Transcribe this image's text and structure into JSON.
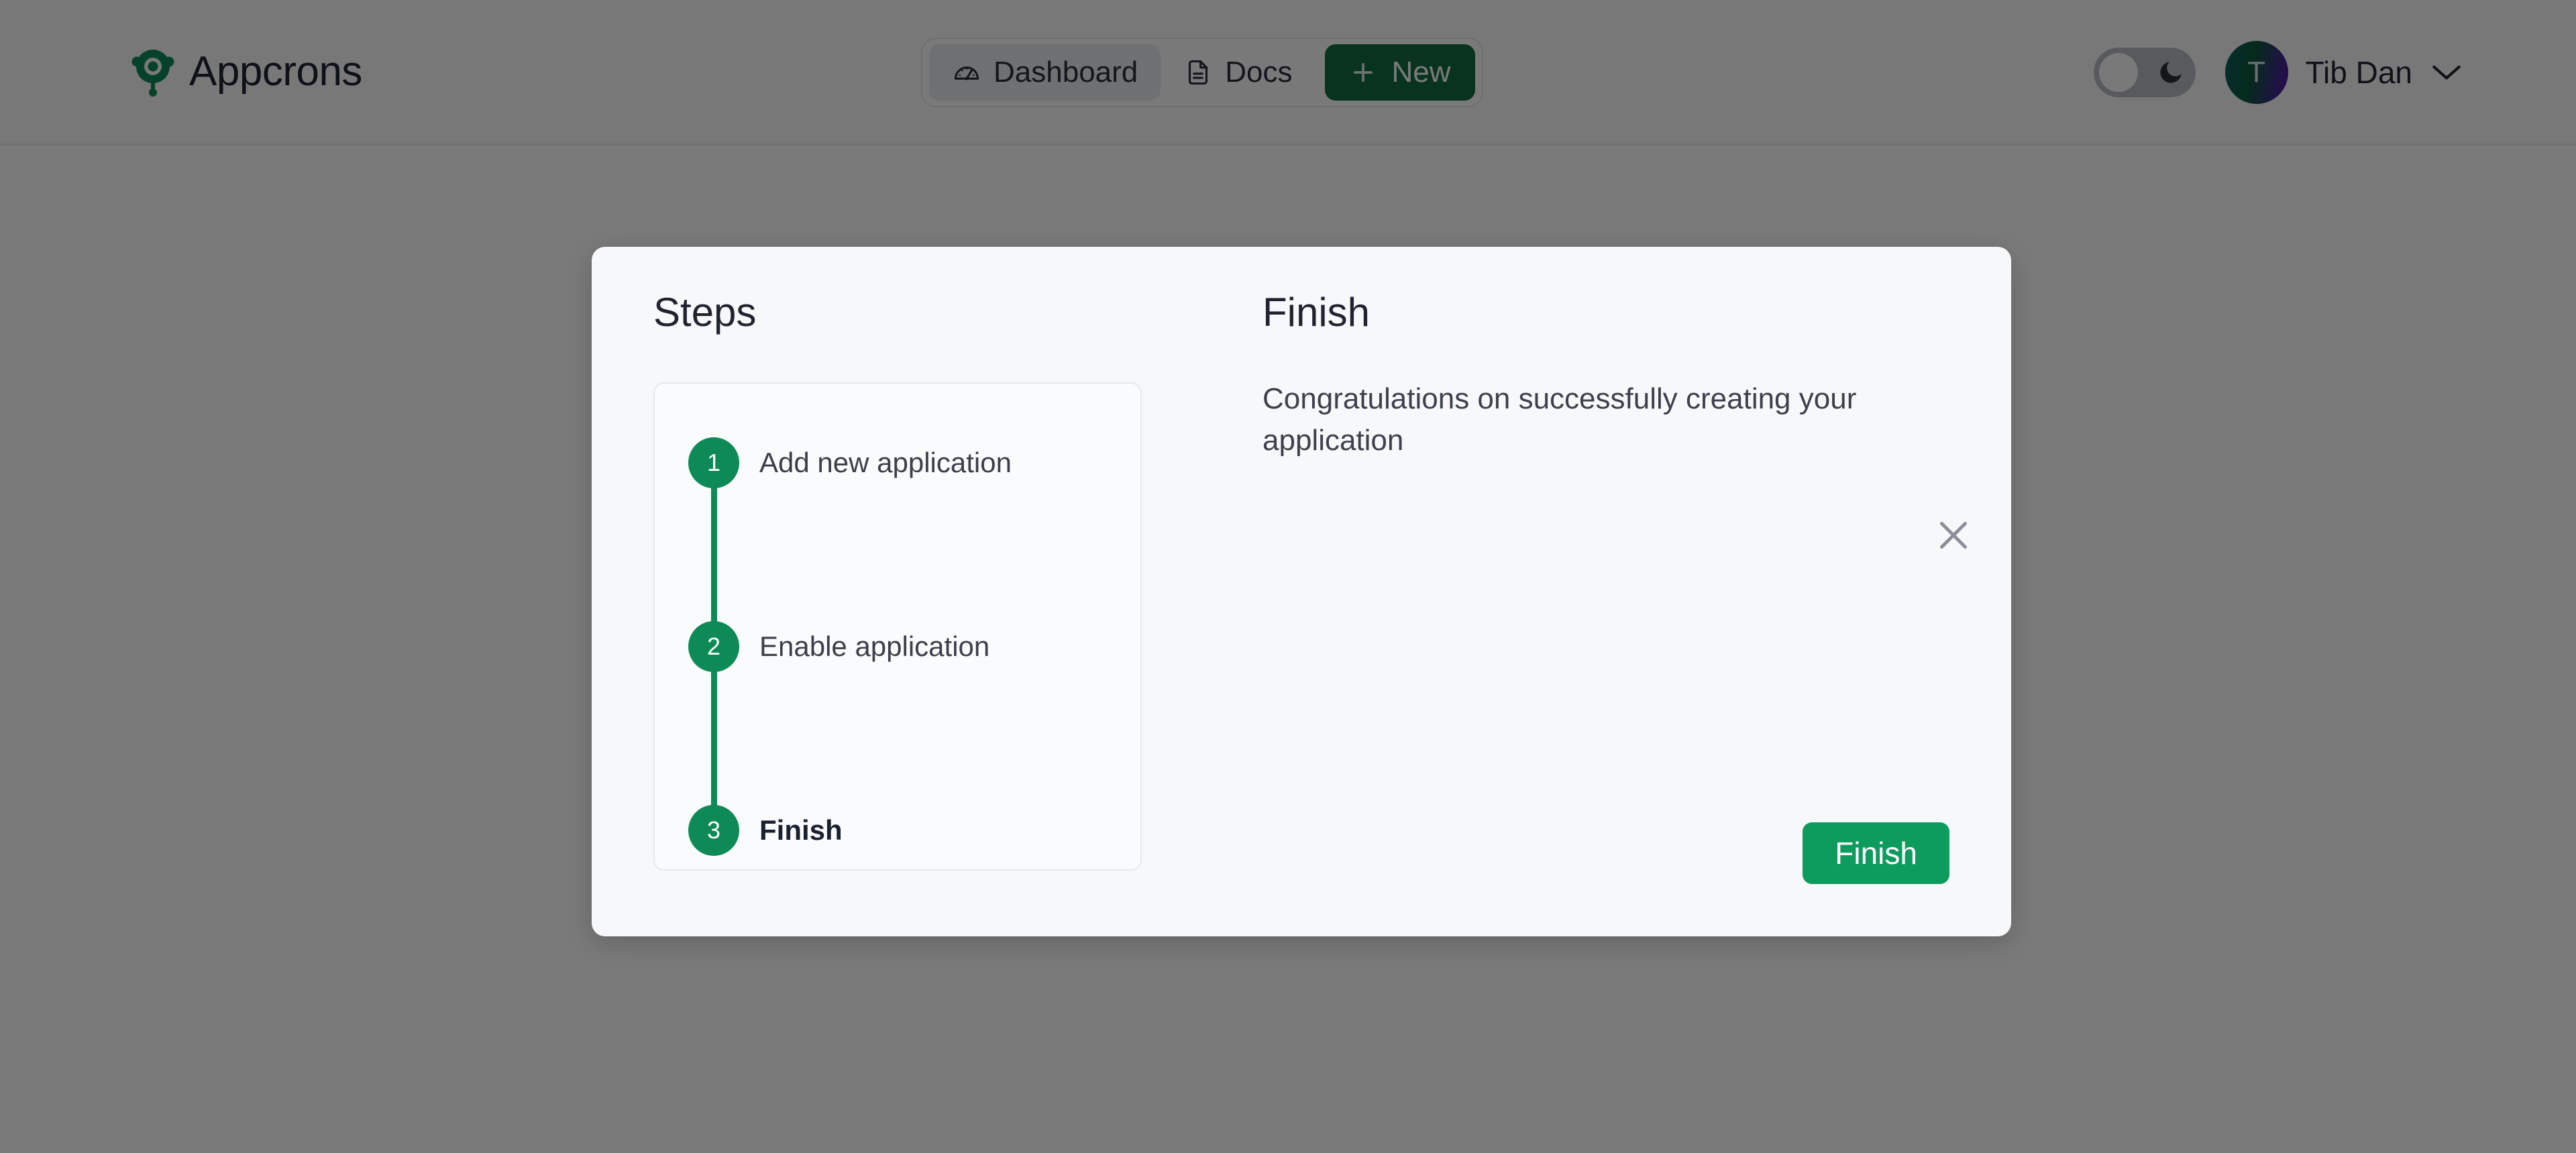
{
  "header": {
    "brand_name": "Appcrons",
    "brand_icon": "target-radar-logo-icon",
    "nav": [
      {
        "label": "Dashboard",
        "icon": "gauge-icon",
        "active": true
      },
      {
        "label": "Docs",
        "icon": "document-icon",
        "active": false
      }
    ],
    "new_button": {
      "label": "New",
      "icon": "plus-icon"
    },
    "theme_toggle": {
      "icon": "moon-icon",
      "state": "off"
    },
    "user": {
      "initial": "T",
      "name": "Tib Dan",
      "chevron_icon": "chevron-down-icon"
    }
  },
  "modal": {
    "close_icon": "close-icon",
    "steps_title": "Steps",
    "steps": [
      {
        "number": "1",
        "label": "Add new application",
        "current": false
      },
      {
        "number": "2",
        "label": "Enable application",
        "current": false
      },
      {
        "number": "3",
        "label": "Finish",
        "current": true
      }
    ],
    "detail": {
      "title": "Finish",
      "message": "Congratulations on successfully creating your application",
      "primary_button": "Finish"
    }
  },
  "colors": {
    "brand_green": "#0d8a56",
    "button_green": "#0d9b5e",
    "new_button_green": "#116b3f",
    "overlay": "rgba(0,0,0,0.52)"
  }
}
